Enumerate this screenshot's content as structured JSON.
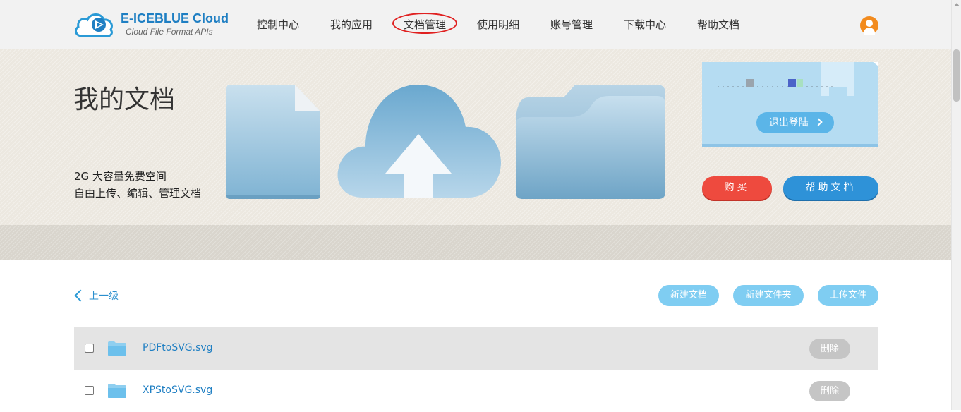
{
  "brand": {
    "title": "E-ICEBLUE Cloud",
    "subtitle": "Cloud File Format APIs"
  },
  "nav": {
    "items": [
      "控制中心",
      "我的应用",
      "文档管理",
      "使用明细",
      "账号管理",
      "下载中心",
      "帮助文档"
    ],
    "active_index": 2
  },
  "banner": {
    "title": "我的文档",
    "line1": "2G 大容量免费空间",
    "line2": "自由上传、编辑、管理文档"
  },
  "account": {
    "logout_label": "退出登陆",
    "buy_label": "购买",
    "help_label": "帮助文档"
  },
  "toolbar": {
    "back_label": "上一级",
    "new_doc_label": "新建文档",
    "new_folder_label": "新建文件夹",
    "upload_label": "上传文件"
  },
  "files": [
    {
      "name": "PDFtoSVG.svg",
      "delete_label": "删除"
    },
    {
      "name": "XPStoSVG.svg",
      "delete_label": "删除"
    }
  ],
  "colors": {
    "brand_blue": "#1f7fc3",
    "buy_red": "#ee4a3e",
    "help_blue": "#2e92d8",
    "tool_blue": "#7fcdf2",
    "avatar_orange": "#f28b1e",
    "active_ring": "#e02020"
  },
  "icons": [
    "cloud-logo-icon",
    "user-avatar-icon",
    "chevron-left-icon",
    "chevron-right-icon",
    "folder-icon"
  ]
}
